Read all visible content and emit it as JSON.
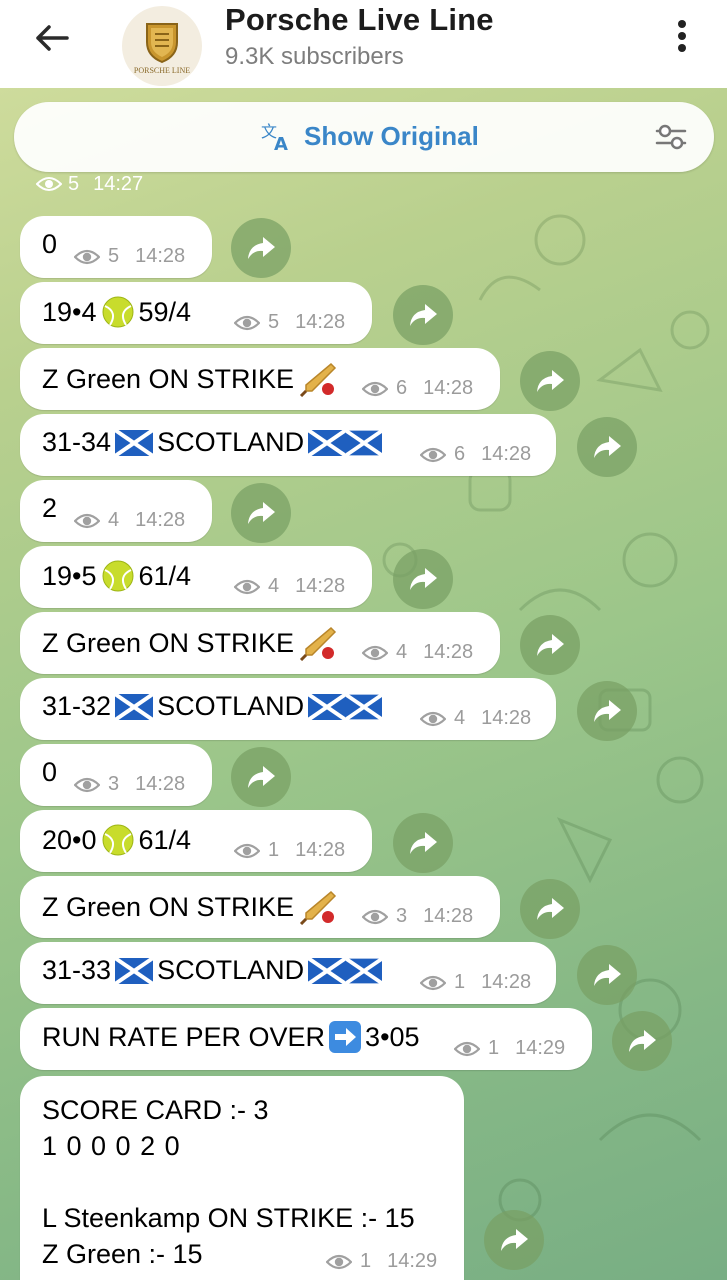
{
  "channel": {
    "name": "Porsche Live Line",
    "subscribers": "9.3K subscribers",
    "avatar_caption": "PORSCHE LINE"
  },
  "translate_bar": {
    "label": "Show Original"
  },
  "top_partial": {
    "views": "5",
    "time": "14:27"
  },
  "messages": [
    {
      "text": "0",
      "views": "5",
      "time": "14:28"
    },
    {
      "text_a": "19•4",
      "emoji": "tennis-ball",
      "text_b": "59/4",
      "views": "5",
      "time": "14:28"
    },
    {
      "text": "Z Green ON STRIKE",
      "emoji": "cricket-bat",
      "views": "6",
      "time": "14:28"
    },
    {
      "text_a": "31-34",
      "emoji": "scotland-flag",
      "text_b": "SCOTLAND",
      "views": "6",
      "time": "14:28"
    },
    {
      "text": "2",
      "views": "4",
      "time": "14:28"
    },
    {
      "text_a": "19•5",
      "emoji": "tennis-ball",
      "text_b": "61/4",
      "views": "4",
      "time": "14:28"
    },
    {
      "text": "Z Green ON STRIKE",
      "emoji": "cricket-bat",
      "views": "4",
      "time": "14:28"
    },
    {
      "text_a": "31-32",
      "emoji": "scotland-flag",
      "text_b": "SCOTLAND",
      "views": "4",
      "time": "14:28"
    },
    {
      "text": "0",
      "views": "3",
      "time": "14:28"
    },
    {
      "text_a": "20•0",
      "emoji": "tennis-ball",
      "text_b": "61/4",
      "views": "1",
      "time": "14:28"
    },
    {
      "text": "Z Green ON STRIKE",
      "emoji": "cricket-bat",
      "views": "3",
      "time": "14:28"
    },
    {
      "text_a": "31-33",
      "emoji": "scotland-flag",
      "text_b": "SCOTLAND",
      "views": "1",
      "time": "14:28"
    },
    {
      "text_a": "RUN RATE PER OVER",
      "emoji": "right-arrow",
      "text_b": "3•05",
      "views": "1",
      "time": "14:29"
    },
    {
      "line1": "SCORE CARD :- 3",
      "line2": "1 0 0 0 2 0",
      "line3": "",
      "line4": "L Steenkamp ON STRIKE :- 15",
      "line5": "Z Green :- 15",
      "views": "1",
      "time": "14:29"
    }
  ],
  "colors": {
    "accent": "#3a86c8",
    "bubble": "#ffffff",
    "meta": "#9b9b9b",
    "share": "#78a064"
  }
}
